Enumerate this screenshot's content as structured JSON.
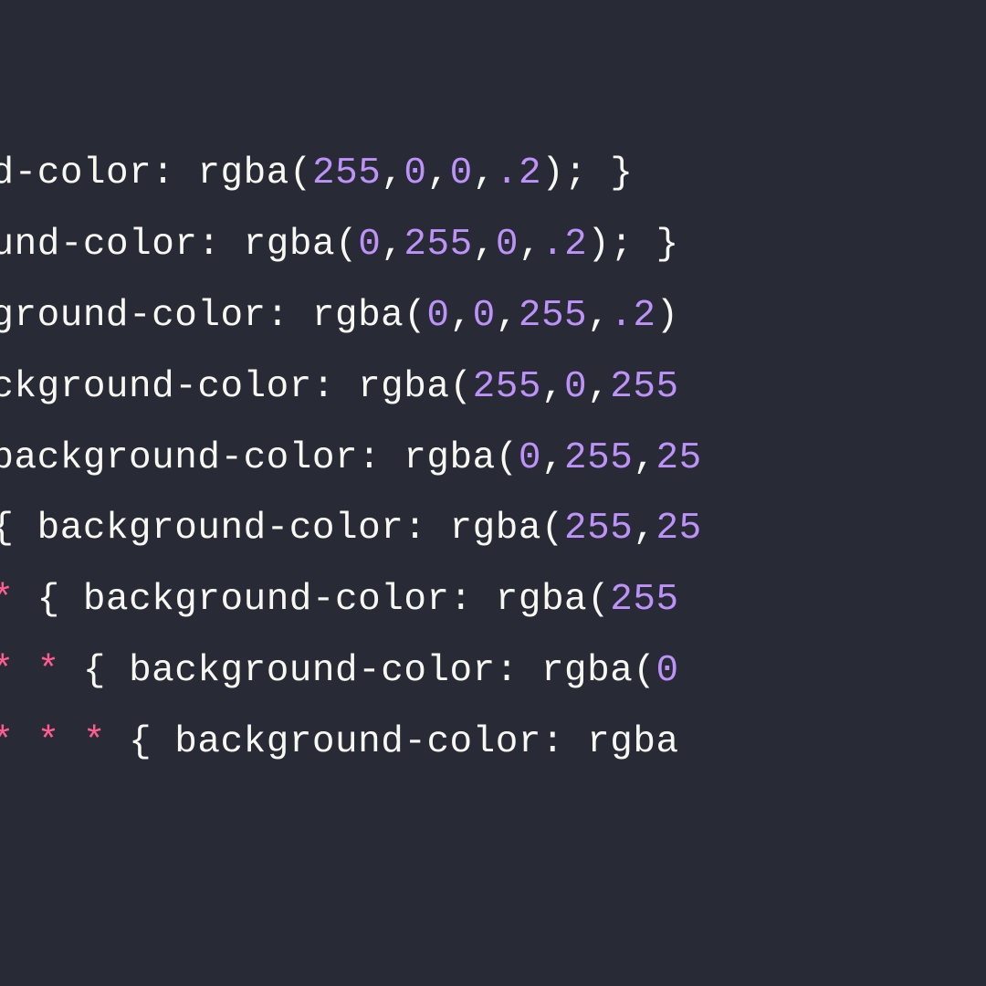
{
  "colors": {
    "background": "#282a36",
    "foreground": "#f8f8f2",
    "number": "#bd93f9",
    "operator": "#ff5d8f"
  },
  "code": {
    "lines": [
      {
        "indent": -135,
        "tokens": [
          {
            "t": "ground-color: rgba(",
            "c": "default"
          },
          {
            "t": "255",
            "c": "number"
          },
          {
            "t": ",",
            "c": "default"
          },
          {
            "t": "0",
            "c": "number"
          },
          {
            "t": ",",
            "c": "default"
          },
          {
            "t": "0",
            "c": "number"
          },
          {
            "t": ",",
            "c": "default"
          },
          {
            "t": ".2",
            "c": "number"
          },
          {
            "t": "); }",
            "c": "default"
          }
        ]
      },
      {
        "indent": -135,
        "tokens": [
          {
            "t": "ckground-color: rgba(",
            "c": "default"
          },
          {
            "t": "0",
            "c": "number"
          },
          {
            "t": ",",
            "c": "default"
          },
          {
            "t": "255",
            "c": "number"
          },
          {
            "t": ",",
            "c": "default"
          },
          {
            "t": "0",
            "c": "number"
          },
          {
            "t": ",",
            "c": "default"
          },
          {
            "t": ".2",
            "c": "number"
          },
          {
            "t": "); }",
            "c": "default"
          }
        ]
      },
      {
        "indent": -110,
        "tokens": [
          {
            "t": "background-color: rgba(",
            "c": "default"
          },
          {
            "t": "0",
            "c": "number"
          },
          {
            "t": ",",
            "c": "default"
          },
          {
            "t": "0",
            "c": "number"
          },
          {
            "t": ",",
            "c": "default"
          },
          {
            "t": "255",
            "c": "number"
          },
          {
            "t": ",",
            "c": "default"
          },
          {
            "t": ".2",
            "c": "number"
          },
          {
            "t": ")",
            "c": "default"
          }
        ]
      },
      {
        "indent": -110,
        "tokens": [
          {
            "t": "{ background-color: rgba(",
            "c": "default"
          },
          {
            "t": "255",
            "c": "number"
          },
          {
            "t": ",",
            "c": "default"
          },
          {
            "t": "0",
            "c": "number"
          },
          {
            "t": ",",
            "c": "default"
          },
          {
            "t": "255",
            "c": "number"
          }
        ]
      },
      {
        "indent": -110,
        "tokens": [
          {
            "t": "*",
            "c": "op"
          },
          {
            "t": " { background-color: rgba(",
            "c": "default"
          },
          {
            "t": "0",
            "c": "number"
          },
          {
            "t": ",",
            "c": "default"
          },
          {
            "t": "255",
            "c": "number"
          },
          {
            "t": ",",
            "c": "default"
          },
          {
            "t": "25",
            "c": "number"
          }
        ]
      },
      {
        "indent": -110,
        "tokens": [
          {
            "t": "*",
            "c": "op"
          },
          {
            "t": " ",
            "c": "default"
          },
          {
            "t": "*",
            "c": "op"
          },
          {
            "t": " { background-color: rgba(",
            "c": "default"
          },
          {
            "t": "255",
            "c": "number"
          },
          {
            "t": ",",
            "c": "default"
          },
          {
            "t": "25",
            "c": "number"
          }
        ]
      },
      {
        "indent": -110,
        "tokens": [
          {
            "t": "*",
            "c": "op"
          },
          {
            "t": " ",
            "c": "default"
          },
          {
            "t": "*",
            "c": "op"
          },
          {
            "t": " ",
            "c": "default"
          },
          {
            "t": "*",
            "c": "op"
          },
          {
            "t": " { background-color: rgba(",
            "c": "default"
          },
          {
            "t": "255",
            "c": "number"
          }
        ]
      },
      {
        "indent": -110,
        "tokens": [
          {
            "t": "*",
            "c": "op"
          },
          {
            "t": " ",
            "c": "default"
          },
          {
            "t": "*",
            "c": "op"
          },
          {
            "t": " ",
            "c": "default"
          },
          {
            "t": "*",
            "c": "op"
          },
          {
            "t": " ",
            "c": "default"
          },
          {
            "t": "*",
            "c": "op"
          },
          {
            "t": " { background-color: rgba(",
            "c": "default"
          },
          {
            "t": "0",
            "c": "number"
          }
        ]
      },
      {
        "indent": -110,
        "tokens": [
          {
            "t": "*",
            "c": "op"
          },
          {
            "t": " ",
            "c": "default"
          },
          {
            "t": "*",
            "c": "op"
          },
          {
            "t": " ",
            "c": "default"
          },
          {
            "t": "*",
            "c": "op"
          },
          {
            "t": " ",
            "c": "default"
          },
          {
            "t": "*",
            "c": "op"
          },
          {
            "t": " ",
            "c": "default"
          },
          {
            "t": "*",
            "c": "op"
          },
          {
            "t": " { background-color: rgba",
            "c": "default"
          }
        ]
      }
    ]
  }
}
